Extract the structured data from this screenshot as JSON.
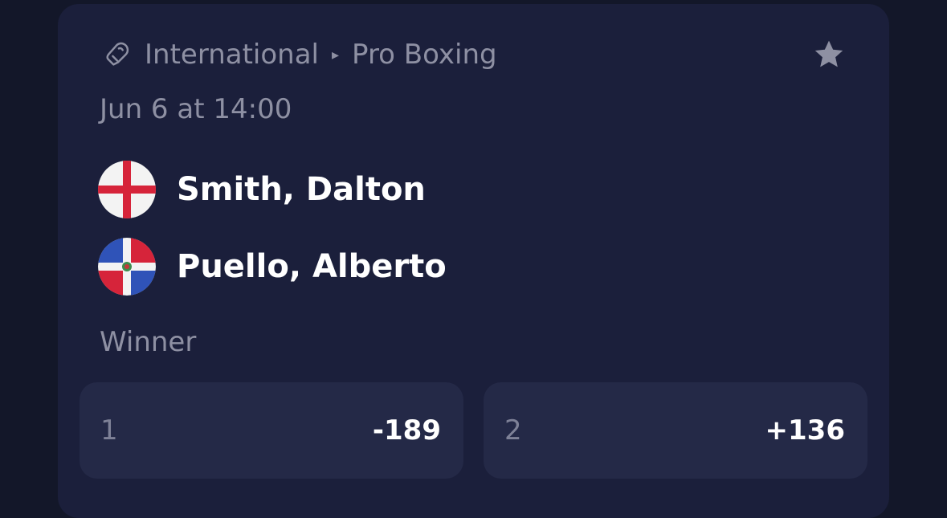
{
  "breadcrumb": {
    "icon": "boxing-glove-icon",
    "region": "International",
    "separator": "▸",
    "league": "Pro Boxing"
  },
  "favorite_icon": "star-icon",
  "event": {
    "datetime": "Jun 6 at 14:00",
    "competitors": [
      {
        "name": "Smith, Dalton",
        "flag": "england-flag-icon"
      },
      {
        "name": "Puello, Alberto",
        "flag": "dominican-republic-flag-icon"
      }
    ]
  },
  "market": {
    "title": "Winner",
    "outcomes": [
      {
        "label": "1",
        "odds": "-189"
      },
      {
        "label": "2",
        "odds": "+136"
      }
    ]
  },
  "colors": {
    "background": "#131729",
    "card": "#1b1f3b",
    "button": "#242947",
    "muted_text": "#8e90a3",
    "text": "#ffffff"
  }
}
